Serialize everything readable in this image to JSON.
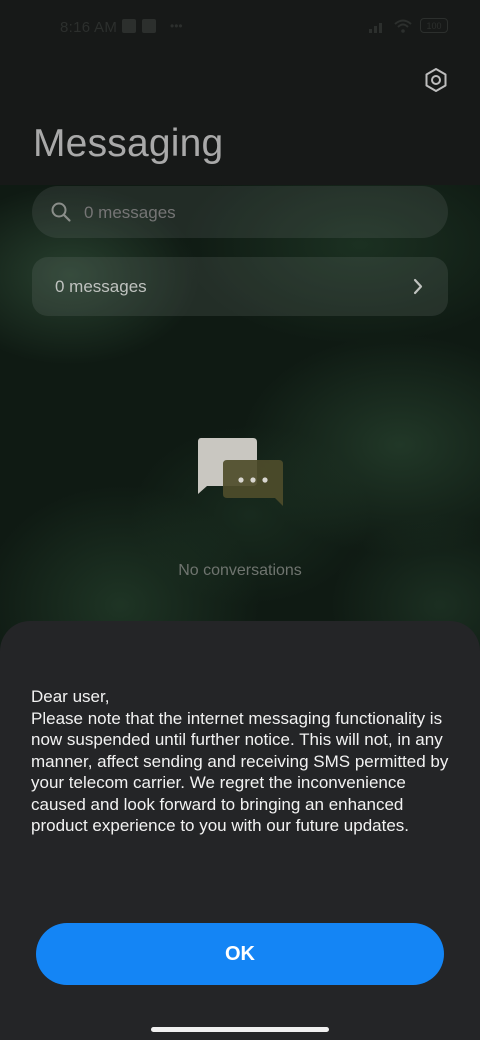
{
  "status_bar": {
    "time": "8:16 AM",
    "battery": "100"
  },
  "header": {
    "title": "Messaging",
    "settings_icon": "gear-icon"
  },
  "search": {
    "placeholder": "0 messages",
    "icon": "search-icon"
  },
  "messages_row": {
    "label": "0 messages",
    "icon": "chevron-right-icon"
  },
  "empty_state": {
    "icon": "chat-bubbles-icon",
    "label": "No conversations"
  },
  "dialog": {
    "text": "Dear user,\nPlease note that the internet messaging functionality is now suspended until further notice. This will not, in any manner, affect sending and receiving SMS permitted by your telecom carrier. We regret the inconvenience caused and look forward to bringing an enhanced product experience to you with our future updates.",
    "ok_label": "OK"
  },
  "colors": {
    "accent": "#1485f5",
    "sheet_background": "#242527",
    "title_text": "#a9a9a9"
  }
}
